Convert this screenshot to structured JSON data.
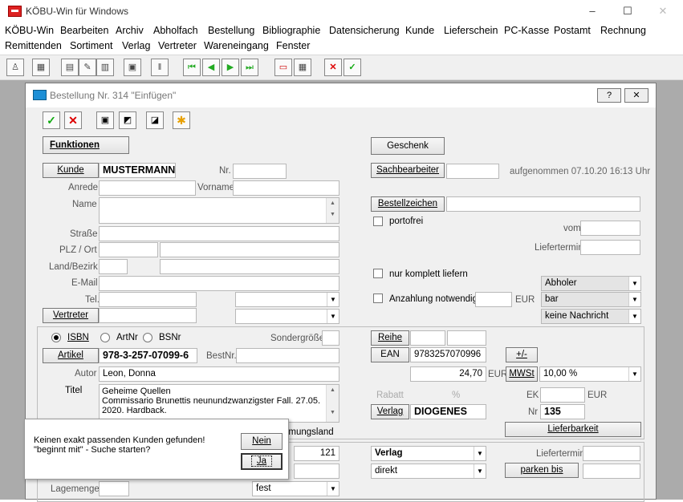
{
  "window": {
    "title": "KÖBU-Win für Windows",
    "min": "–",
    "max": "☐",
    "close": "✕"
  },
  "menu": {
    "row1": [
      "KÖBU-Win",
      "Bearbeiten",
      "Archiv",
      "Abholfach",
      "Bestellung",
      "Bibliographie",
      "Datensicherung",
      "Kunde",
      "Lieferschein",
      "PC-Kasse",
      "Postamt",
      "Rechnung"
    ],
    "row2": [
      "Remittenden",
      "Sortiment",
      "Verlag",
      "Vertreter",
      "Wareneingang",
      "Fenster"
    ]
  },
  "dialog": {
    "title": "Bestellung Nr. 314 \"Einfügen\"",
    "help_btn": "?",
    "close_btn": "✕",
    "funktionen": "Funktionen",
    "geschenk": "Geschenk",
    "kunde_btn": "Kunde",
    "kunde_value": "MUSTERMANN",
    "nr_label": "Nr.",
    "sachbearbeiter_btn": "Sachbearbeiter",
    "aufgenommen": "aufgenommen 07.10.20  16:13 Uhr",
    "anrede_label": "Anrede",
    "vorname_label": "Vorname",
    "name_label": "Name",
    "bestellzeichen_btn": "Bestellzeichen",
    "portofrei": "portofrei",
    "vom_label": "vom",
    "strasse_label": "Straße",
    "plz_label": "PLZ / Ort",
    "liefertermin_label": "Liefertermin",
    "land_label": "Land/Bezirk",
    "email_label": "E-Mail",
    "nur_komplett": "nur komplett liefern",
    "abholer": "Abholer",
    "tel_label": "Tel.",
    "anzahlung": "Anzahlung notwendig",
    "eur": "EUR",
    "bar": "bar",
    "vertreter_btn": "Vertreter",
    "keine_nachricht": "keine Nachricht",
    "isbn_radio": "ISBN",
    "artnr_radio": "ArtNr",
    "bsnr_radio": "BSNr",
    "sondergroesse": "Sondergröße",
    "reihe_btn": "Reihe",
    "artikel_btn": "Artikel",
    "artikel_value": "978-3-257-07099-6",
    "bestnr_label": "BestNr.",
    "ean_btn": "EAN",
    "ean_value": "9783257070996",
    "plusminus_btn": "+/-",
    "autor_label": "Autor",
    "autor_value": "Leon, Donna",
    "price_value": "24,70",
    "mwst_btn": "MWSt",
    "mwst_value": "10,00 %",
    "titel_label": "Titel",
    "titel_lines": [
      "Geheime Quellen",
      "Commissario Brunettis neunundzwanzigster Fall. 27.05.",
      "2020. Hardback."
    ],
    "rabatt_label": "Rabatt",
    "percent": "%",
    "ek_label": "EK",
    "verlag_btn": "Verlag",
    "verlag_value": "DIOGENES",
    "nr_short": "Nr",
    "nr_value": "135",
    "herkunft_partial": "nmungsland",
    "lieferbarkeit_btn": "Lieferbarkeit",
    "qty_value": "121",
    "verlag_select": "Verlag",
    "liefertermin2": "Liefertermin",
    "direkt": "direkt",
    "parken_btn": "parken bis",
    "lagermenge_label": "Lagemenge",
    "fest": "fest"
  },
  "popup": {
    "line1": "Keinen exakt passenden Kunden gefunden!",
    "line2": "\"beginnt mit\" - Suche starten?",
    "nein": "Nein",
    "ja": "Ja"
  }
}
